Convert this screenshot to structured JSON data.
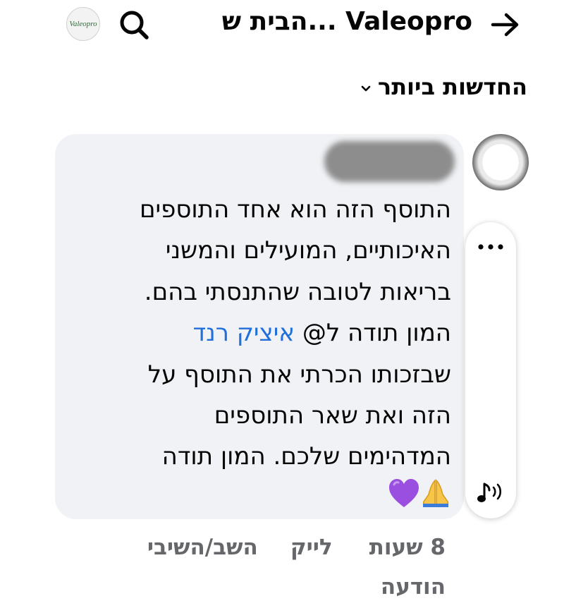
{
  "header": {
    "title": "הבית ש... Valeopro",
    "logo_text": "Valeopro",
    "icons": {
      "back": "arrow-right-icon",
      "search": "search-icon"
    }
  },
  "sort": {
    "label": "החדשות ביותר",
    "icon": "chevron-down-icon"
  },
  "comment": {
    "text_before_mention": "התוסף הזה הוא אחד התוספים\nהאיכותיים, המועילים והמשני\nבריאות לטובה שהתנסתי בהם.\nהמון תודה ל@ ",
    "mention": "איציק רנד",
    "text_after_mention": "\nשבזכותו הכרתי את התוסף על\nהזה ואת שאר התוספים\nהמדהימים שלכם. המון תודה\n",
    "emojis": [
      "folded-hands-emoji",
      "purple-heart-emoji"
    ],
    "time": "8 שעות",
    "like_label": "לייק",
    "reply_label": "השב/השיבי",
    "report_label": "הודעה"
  },
  "side_actions": {
    "more_icon": "more-dots-icon",
    "audio_icon": "audio-note-icon"
  },
  "colors": {
    "mention": "#216fdb",
    "bubble": "#f0f2f5",
    "meta": "#65676b"
  }
}
